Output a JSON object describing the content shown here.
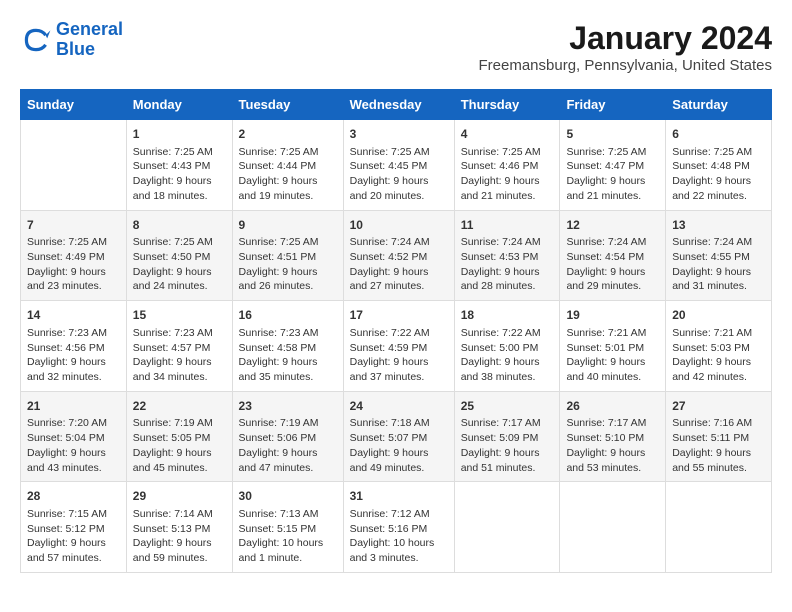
{
  "header": {
    "logo_line1": "General",
    "logo_line2": "Blue",
    "title": "January 2024",
    "subtitle": "Freemansburg, Pennsylvania, United States"
  },
  "days_of_week": [
    "Sunday",
    "Monday",
    "Tuesday",
    "Wednesday",
    "Thursday",
    "Friday",
    "Saturday"
  ],
  "weeks": [
    [
      {
        "day": "",
        "content": ""
      },
      {
        "day": "1",
        "content": "Sunrise: 7:25 AM\nSunset: 4:43 PM\nDaylight: 9 hours\nand 18 minutes."
      },
      {
        "day": "2",
        "content": "Sunrise: 7:25 AM\nSunset: 4:44 PM\nDaylight: 9 hours\nand 19 minutes."
      },
      {
        "day": "3",
        "content": "Sunrise: 7:25 AM\nSunset: 4:45 PM\nDaylight: 9 hours\nand 20 minutes."
      },
      {
        "day": "4",
        "content": "Sunrise: 7:25 AM\nSunset: 4:46 PM\nDaylight: 9 hours\nand 21 minutes."
      },
      {
        "day": "5",
        "content": "Sunrise: 7:25 AM\nSunset: 4:47 PM\nDaylight: 9 hours\nand 21 minutes."
      },
      {
        "day": "6",
        "content": "Sunrise: 7:25 AM\nSunset: 4:48 PM\nDaylight: 9 hours\nand 22 minutes."
      }
    ],
    [
      {
        "day": "7",
        "content": "Sunrise: 7:25 AM\nSunset: 4:49 PM\nDaylight: 9 hours\nand 23 minutes."
      },
      {
        "day": "8",
        "content": "Sunrise: 7:25 AM\nSunset: 4:50 PM\nDaylight: 9 hours\nand 24 minutes."
      },
      {
        "day": "9",
        "content": "Sunrise: 7:25 AM\nSunset: 4:51 PM\nDaylight: 9 hours\nand 26 minutes."
      },
      {
        "day": "10",
        "content": "Sunrise: 7:24 AM\nSunset: 4:52 PM\nDaylight: 9 hours\nand 27 minutes."
      },
      {
        "day": "11",
        "content": "Sunrise: 7:24 AM\nSunset: 4:53 PM\nDaylight: 9 hours\nand 28 minutes."
      },
      {
        "day": "12",
        "content": "Sunrise: 7:24 AM\nSunset: 4:54 PM\nDaylight: 9 hours\nand 29 minutes."
      },
      {
        "day": "13",
        "content": "Sunrise: 7:24 AM\nSunset: 4:55 PM\nDaylight: 9 hours\nand 31 minutes."
      }
    ],
    [
      {
        "day": "14",
        "content": "Sunrise: 7:23 AM\nSunset: 4:56 PM\nDaylight: 9 hours\nand 32 minutes."
      },
      {
        "day": "15",
        "content": "Sunrise: 7:23 AM\nSunset: 4:57 PM\nDaylight: 9 hours\nand 34 minutes."
      },
      {
        "day": "16",
        "content": "Sunrise: 7:23 AM\nSunset: 4:58 PM\nDaylight: 9 hours\nand 35 minutes."
      },
      {
        "day": "17",
        "content": "Sunrise: 7:22 AM\nSunset: 4:59 PM\nDaylight: 9 hours\nand 37 minutes."
      },
      {
        "day": "18",
        "content": "Sunrise: 7:22 AM\nSunset: 5:00 PM\nDaylight: 9 hours\nand 38 minutes."
      },
      {
        "day": "19",
        "content": "Sunrise: 7:21 AM\nSunset: 5:01 PM\nDaylight: 9 hours\nand 40 minutes."
      },
      {
        "day": "20",
        "content": "Sunrise: 7:21 AM\nSunset: 5:03 PM\nDaylight: 9 hours\nand 42 minutes."
      }
    ],
    [
      {
        "day": "21",
        "content": "Sunrise: 7:20 AM\nSunset: 5:04 PM\nDaylight: 9 hours\nand 43 minutes."
      },
      {
        "day": "22",
        "content": "Sunrise: 7:19 AM\nSunset: 5:05 PM\nDaylight: 9 hours\nand 45 minutes."
      },
      {
        "day": "23",
        "content": "Sunrise: 7:19 AM\nSunset: 5:06 PM\nDaylight: 9 hours\nand 47 minutes."
      },
      {
        "day": "24",
        "content": "Sunrise: 7:18 AM\nSunset: 5:07 PM\nDaylight: 9 hours\nand 49 minutes."
      },
      {
        "day": "25",
        "content": "Sunrise: 7:17 AM\nSunset: 5:09 PM\nDaylight: 9 hours\nand 51 minutes."
      },
      {
        "day": "26",
        "content": "Sunrise: 7:17 AM\nSunset: 5:10 PM\nDaylight: 9 hours\nand 53 minutes."
      },
      {
        "day": "27",
        "content": "Sunrise: 7:16 AM\nSunset: 5:11 PM\nDaylight: 9 hours\nand 55 minutes."
      }
    ],
    [
      {
        "day": "28",
        "content": "Sunrise: 7:15 AM\nSunset: 5:12 PM\nDaylight: 9 hours\nand 57 minutes."
      },
      {
        "day": "29",
        "content": "Sunrise: 7:14 AM\nSunset: 5:13 PM\nDaylight: 9 hours\nand 59 minutes."
      },
      {
        "day": "30",
        "content": "Sunrise: 7:13 AM\nSunset: 5:15 PM\nDaylight: 10 hours\nand 1 minute."
      },
      {
        "day": "31",
        "content": "Sunrise: 7:12 AM\nSunset: 5:16 PM\nDaylight: 10 hours\nand 3 minutes."
      },
      {
        "day": "",
        "content": ""
      },
      {
        "day": "",
        "content": ""
      },
      {
        "day": "",
        "content": ""
      }
    ]
  ]
}
